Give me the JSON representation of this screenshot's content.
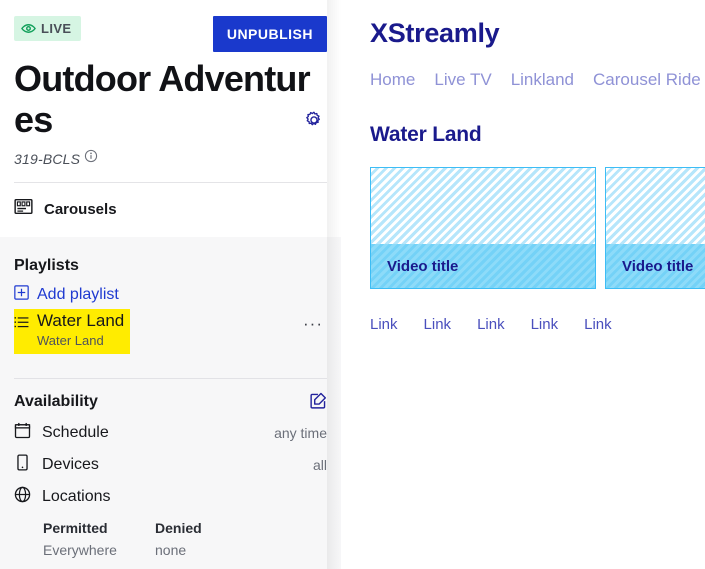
{
  "editor": {
    "status_badge": {
      "label": "LIVE",
      "icon": "eye-icon",
      "bg": "#d6f5e3",
      "fg": "#4a4f58"
    },
    "unpublish_label": "UNPUBLISH",
    "title": "Outdoor Adventures",
    "settings_icon": "gear-icon",
    "code": "319-BCLS",
    "info_icon": "info-circle-icon",
    "carousels": {
      "label": "Carousels",
      "icon": "carousel-icon"
    },
    "playlists": {
      "section_title": "Playlists",
      "add_label": "Add playlist",
      "add_icon": "plus-square-icon",
      "items": [
        {
          "name": "Water Land",
          "subtitle": "Water Land",
          "icon": "list-icon",
          "selected": true,
          "highlight_color": "#ffec00",
          "menu_label": "···"
        }
      ]
    },
    "availability": {
      "section_title": "Availability",
      "edit_icon": "edit-square-icon",
      "rows": [
        {
          "label": "Schedule",
          "value": "any time",
          "icon": "calendar-icon"
        },
        {
          "label": "Devices",
          "value": "all",
          "icon": "phone-icon"
        },
        {
          "label": "Locations",
          "value": "",
          "icon": "globe-icon"
        }
      ],
      "locations": {
        "permitted_header": "Permitted",
        "permitted_value": "Everywhere",
        "denied_header": "Denied",
        "denied_value": "none"
      }
    }
  },
  "preview": {
    "brand": "XStreamly",
    "brand_color": "#1a1a8c",
    "nav": [
      {
        "label": "Home"
      },
      {
        "label": "Live TV"
      },
      {
        "label": "Linkland"
      },
      {
        "label": "Carousel Ride"
      }
    ],
    "carousel_title": "Water Land",
    "cards": [
      {
        "title": "Video title"
      },
      {
        "title": "Video title"
      }
    ],
    "links": [
      {
        "label": "Link"
      },
      {
        "label": "Link"
      },
      {
        "label": "Link"
      },
      {
        "label": "Link"
      },
      {
        "label": "Link"
      }
    ]
  }
}
